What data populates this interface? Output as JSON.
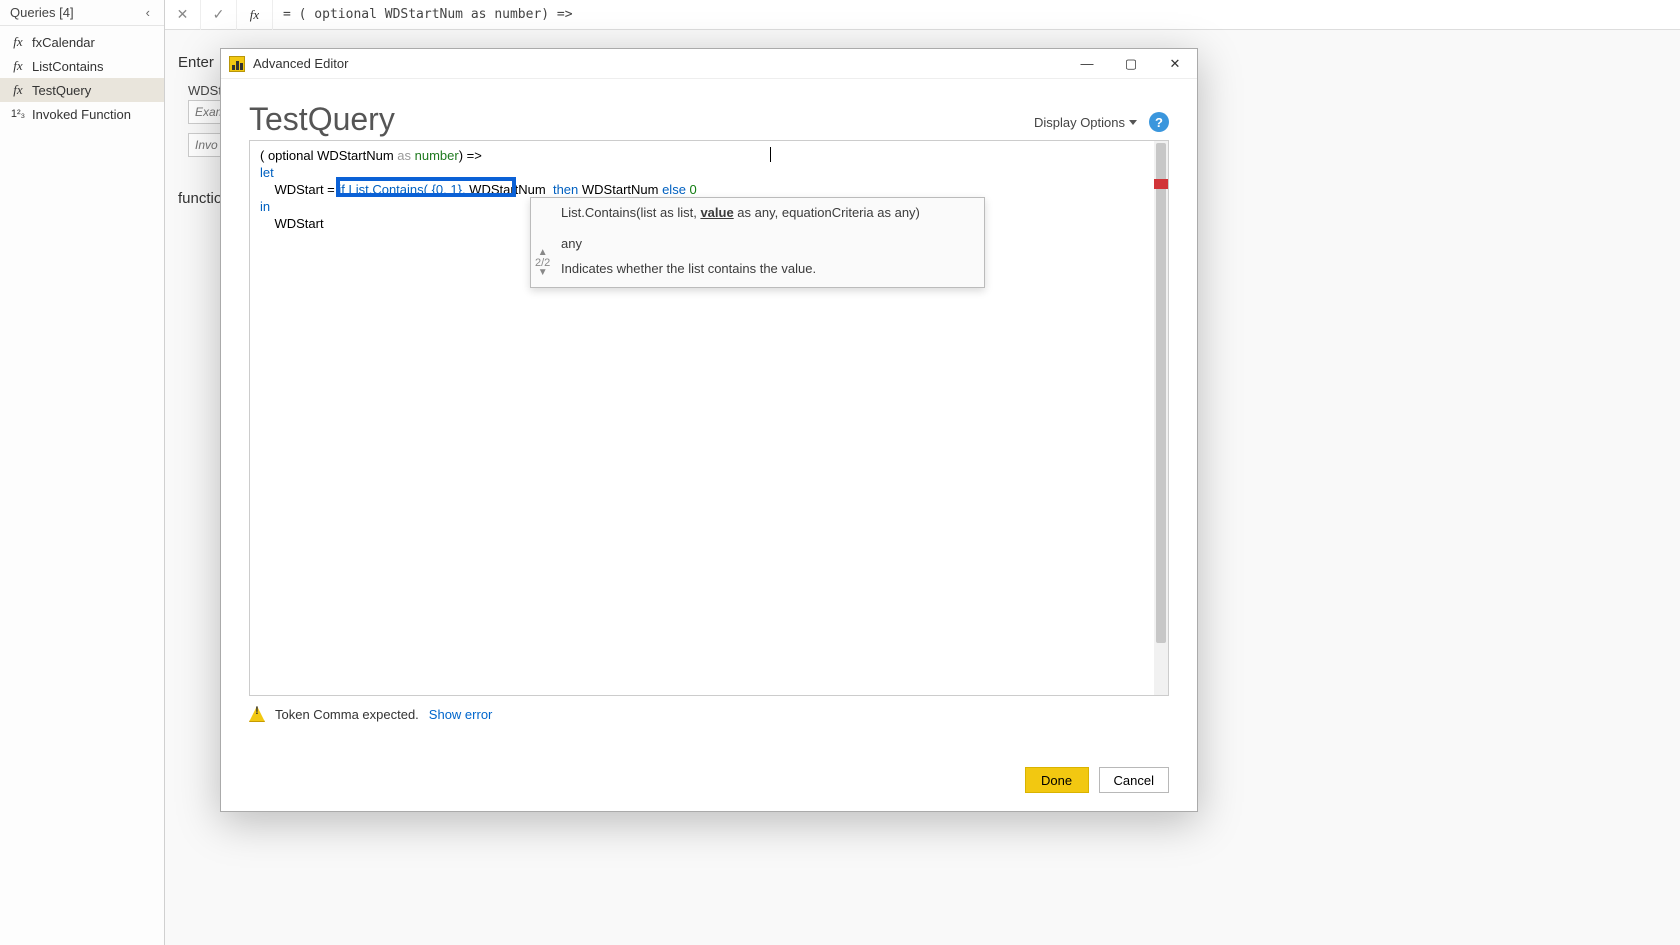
{
  "sidebar": {
    "header": "Queries [4]",
    "items": [
      {
        "label": "fxCalendar",
        "icon": "fx"
      },
      {
        "label": "ListContains",
        "icon": "fx"
      },
      {
        "label": "TestQuery",
        "icon": "fx",
        "selected": true
      },
      {
        "label": "Invoked Function",
        "icon": "123"
      }
    ]
  },
  "formula_bar": {
    "text": "= ( optional WDStartNum as number) =>"
  },
  "background": {
    "enter_label": "Enter",
    "param_label": "WDStart",
    "input1_placeholder": "Exam",
    "input2_placeholder": "Invo",
    "function_label": "function"
  },
  "dialog": {
    "title": "Advanced Editor",
    "query_name": "TestQuery",
    "display_options": "Display Options",
    "code": {
      "line1_pre": "( optional WDStartNum ",
      "line1_as": "as",
      "line1_type": " number",
      "line1_post": ") =>",
      "line2": "let",
      "line3_pre": "    WDStart = ",
      "line3_hl": "if List.Contains( {0, 1},",
      "line3_mid": " WDStartNum  ",
      "line3_then": "then",
      "line3_mid2": " WDStartNum ",
      "line3_else": "else",
      "line3_end": " 0",
      "line4": "in",
      "line5": "    WDStart"
    },
    "tooltip": {
      "sig_pre": "List.Contains(list as list, ",
      "sig_value": "value",
      "sig_mid": " as any, equationCriteria as any)",
      "ret": "any",
      "desc": "Indicates whether the list contains the value.",
      "count": "2/2"
    },
    "error": {
      "text": "Token Comma expected.",
      "show": "Show error"
    },
    "buttons": {
      "done": "Done",
      "cancel": "Cancel"
    }
  }
}
